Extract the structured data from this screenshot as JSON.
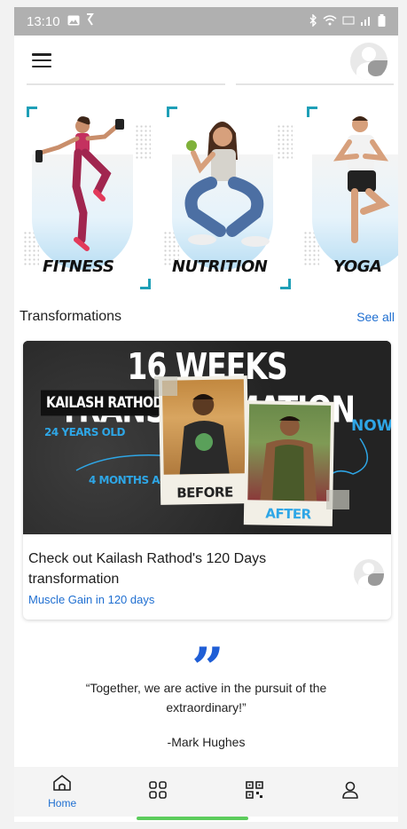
{
  "status_bar": {
    "time": "13:10"
  },
  "categories": [
    {
      "label": "FITNESS"
    },
    {
      "label": "NUTRITION"
    },
    {
      "label": "YOGA"
    }
  ],
  "transformations": {
    "title": "Transformations",
    "see_all": "See all",
    "card": {
      "banner_title": "16 WEEKS TRANSFORMATION",
      "banner_name": "KAILASH RATHOD",
      "banner_age": "24 YEARS OLD",
      "banner_duration": "4 MONTHS AGO",
      "banner_now": "NOW",
      "before_label": "BEFORE",
      "after_label": "AFTER",
      "title": "Check out Kailash Rathod's 120 Days transformation",
      "subtitle": "Muscle Gain in 120 days"
    }
  },
  "quote": {
    "mark": "”",
    "text": "“Together, we are active in the pursuit of the extraordinary!”",
    "author": "-Mark Hughes"
  },
  "bottom_nav": {
    "home_label": "Home"
  },
  "colors": {
    "accent": "#1f6fd1",
    "banner_text_blue": "#2ea6e6",
    "corner_teal": "#1e9fb7"
  }
}
